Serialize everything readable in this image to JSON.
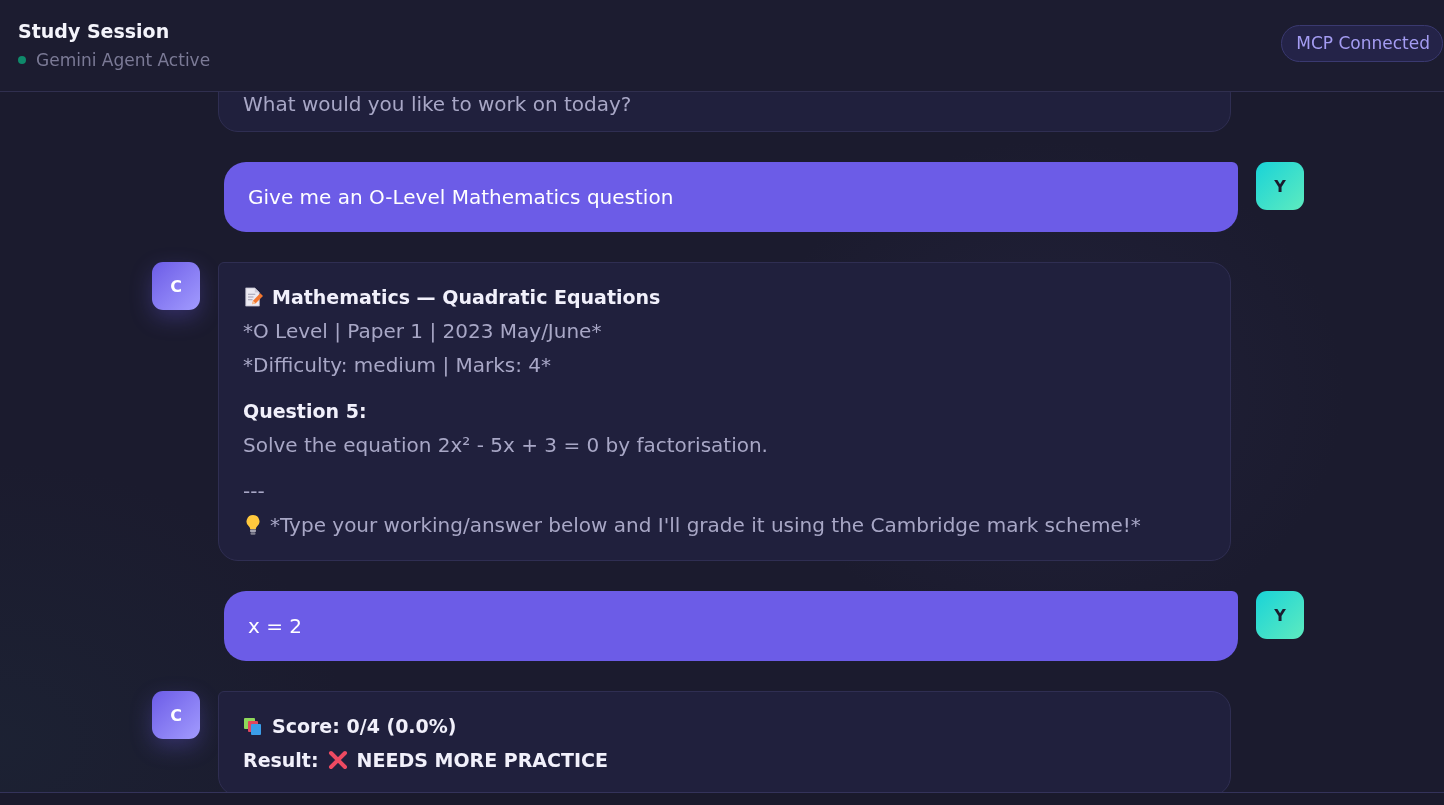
{
  "header": {
    "title": "Study Session",
    "status": {
      "text": "Gemini Agent Active",
      "active": true
    },
    "badge": "MCP Connected"
  },
  "messages": [
    {
      "kind": "assistant",
      "paragraphs": [
        [
          {
            "kind": "text",
            "text": "What would you like to work on today?"
          }
        ]
      ]
    },
    {
      "kind": "user",
      "avatar": "Y",
      "text": "Give me an O-Level Mathematics question"
    },
    {
      "kind": "assistant",
      "avatar": "C",
      "paragraphs": [
        [
          {
            "kind": "title",
            "text": "Mathematics — Quadratic Equations"
          },
          {
            "kind": "text",
            "text": "*O Level | Paper 1 | 2023 May/June*"
          },
          {
            "kind": "text",
            "text": "*Difficulty: medium | Marks: 4*"
          }
        ],
        [
          {
            "kind": "label",
            "text": "Question 5:"
          },
          {
            "kind": "text",
            "text": "Solve the equation 2x² - 5x + 3 = 0 by factorisation."
          }
        ],
        [
          {
            "kind": "text",
            "text": "---"
          },
          {
            "kind": "tip",
            "text": "*Type your working/answer below and I'll grade it using the Cambridge mark scheme!*"
          }
        ]
      ]
    },
    {
      "kind": "user",
      "avatar": "Y",
      "text": "x = 2"
    },
    {
      "kind": "assistant",
      "avatar": "C",
      "paragraphs": [
        [
          {
            "kind": "score",
            "text": "Score: 0/4 (0.0%)"
          },
          {
            "kind": "result",
            "label": "Result:",
            "text": "NEEDS MORE PRACTICE"
          }
        ]
      ]
    }
  ]
}
